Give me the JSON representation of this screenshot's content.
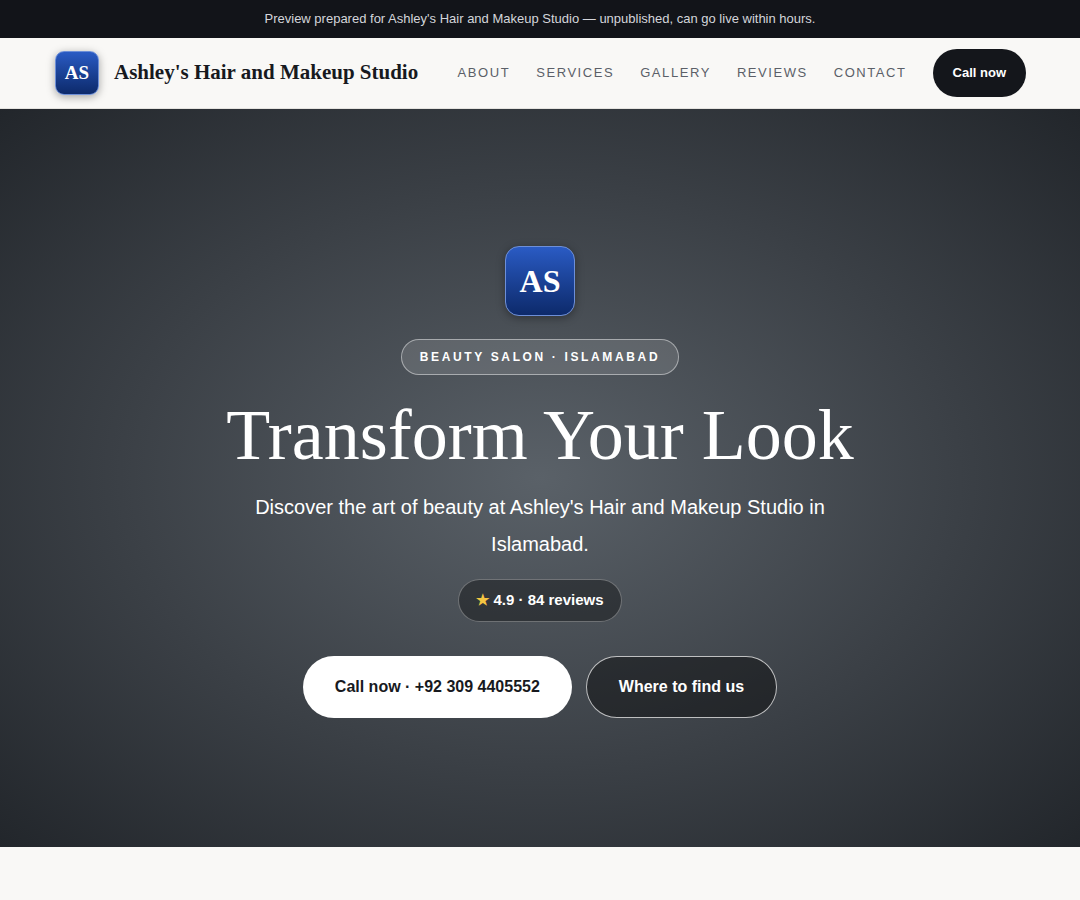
{
  "banner": {
    "text": "Preview prepared for Ashley's Hair and Makeup Studio — unpublished, can go live within hours."
  },
  "brand": {
    "initials": "AS",
    "name": "Ashley's Hair and Makeup Studio"
  },
  "nav": {
    "links": [
      "ABOUT",
      "SERVICES",
      "GALLERY",
      "REVIEWS",
      "CONTACT"
    ],
    "button": "Call now"
  },
  "hero": {
    "logo_initials": "AS",
    "badge": "BEAUTY SALON · ISLAMABAD",
    "title": "Transform Your Look",
    "subtitle": "Discover the art of beauty at Ashley's Hair and Makeup Studio in Islamabad.",
    "rating": {
      "star": "★",
      "text": "4.9 · 84 reviews"
    },
    "buttons": [
      {
        "label": "Call now · +92 309 4405552",
        "kind": "primary"
      },
      {
        "label": "Where to find us",
        "kind": "outline"
      }
    ]
  }
}
